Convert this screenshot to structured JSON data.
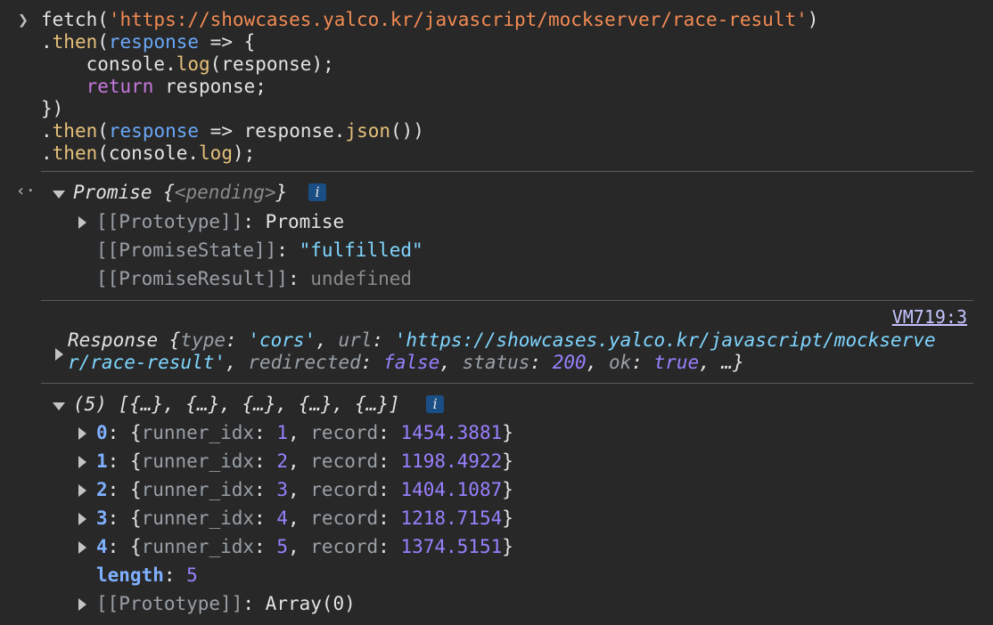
{
  "prompt_icon": "chevron-right-icon",
  "return_icon": "return-arrow-icon",
  "input": {
    "url": "'https://showcases.yalco.kr/javascript/mockserver/race-result'",
    "line1_prefix": "fetch(",
    "line1_suffix": ")",
    "then": "then",
    "response": "response",
    "arrow_brace": " => {",
    "console_prefix": "    console.",
    "log": "log",
    "console_args": "(response);",
    "return_kw": "return",
    "return_rest": " response;",
    "close": "})",
    "arrow": " => ",
    "response_dot": "response.",
    "json": "json",
    "json_tail": "())",
    "console_arg": "(console.",
    "log_tail": ");"
  },
  "promise": {
    "label": "Promise",
    "state_open": "{",
    "pending": "<pending>",
    "state_close": "}",
    "prototype_key": "[[Prototype]]",
    "prototype_val": "Promise",
    "promise_state_key": "[[PromiseState]]",
    "promise_state_val": "\"fulfilled\"",
    "promise_result_key": "[[PromiseResult]]",
    "promise_result_val": "undefined",
    "info": "i"
  },
  "response_log": {
    "source": "VM719:3",
    "label": "Response",
    "type_key": "type",
    "type_val": "'cors'",
    "url_key": "url",
    "url_val_1": "'https://showcases.yalco.kr/javascript/mockserve",
    "url_val_2": "r/race-result'",
    "redirected_key": "redirected",
    "redirected_val": "false",
    "status_key": "status",
    "status_val": "200",
    "ok_key": "ok",
    "ok_val": "true",
    "ellipsis": "…}"
  },
  "array_log": {
    "summary": "(5) [{…}, {…}, {…}, {…}, {…}]",
    "info": "i",
    "items": [
      {
        "index": "0",
        "runner_idx": "1",
        "record": "1454.3881"
      },
      {
        "index": "1",
        "runner_idx": "2",
        "record": "1198.4922"
      },
      {
        "index": "2",
        "runner_idx": "3",
        "record": "1404.1087"
      },
      {
        "index": "3",
        "runner_idx": "4",
        "record": "1218.7154"
      },
      {
        "index": "4",
        "runner_idx": "5",
        "record": "1374.5151"
      }
    ],
    "runner_key": "runner_idx",
    "record_key": "record",
    "length_key": "length",
    "length_val": "5",
    "prototype_key": "[[Prototype]]",
    "prototype_val": "Array(0)"
  }
}
